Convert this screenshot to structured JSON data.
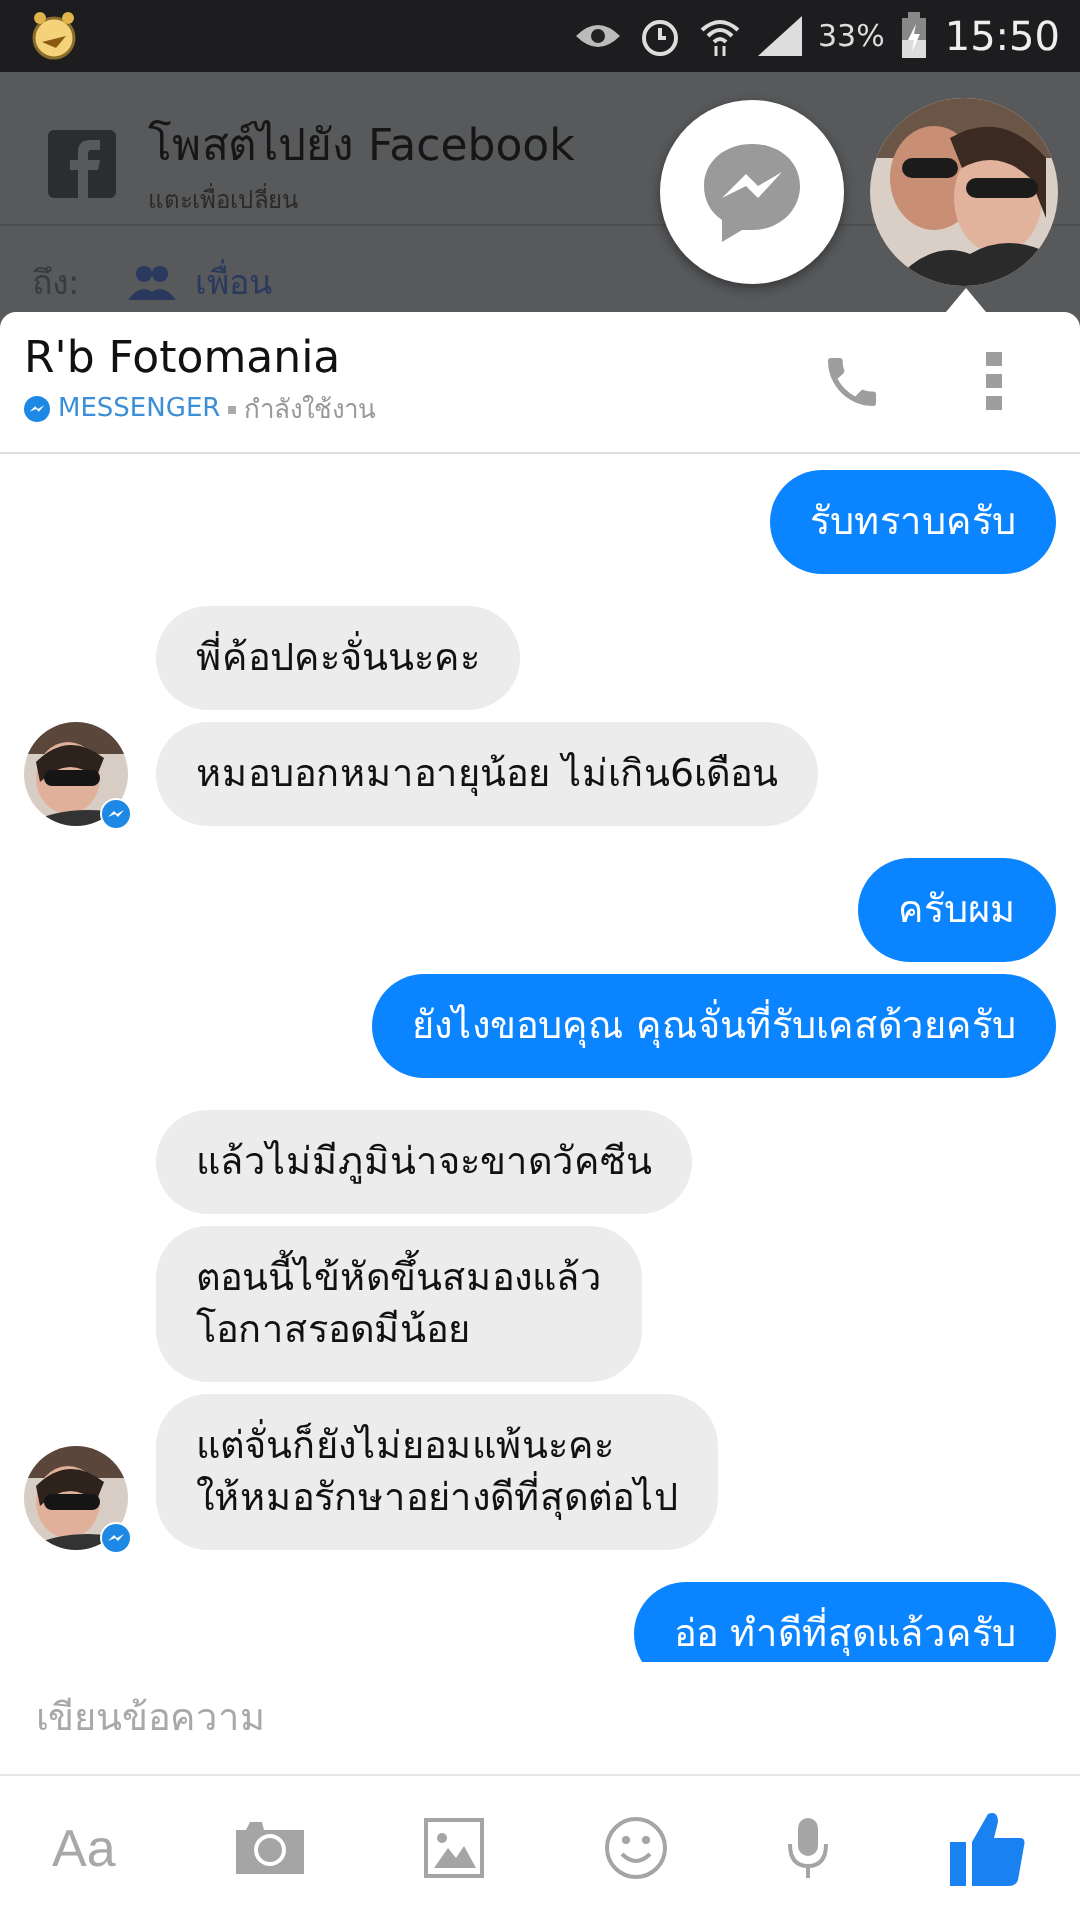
{
  "status_bar": {
    "battery": "33%",
    "time": "15:50"
  },
  "background_app": {
    "title": "โพสต์ไปยัง Facebook",
    "subtitle": "แตะเพื่อเปลี่ยน",
    "to_label": "ถึง:",
    "audience": "เพื่อน"
  },
  "chat_header": {
    "name": "R'b Fotomania",
    "app": "MESSENGER",
    "status": "กำลังใช้งาน"
  },
  "messages": [
    {
      "kind": "outgoing",
      "text": "รับทราบครับ"
    },
    {
      "kind": "incoming",
      "text": "พี่ค้อปคะจั่นนะคะ",
      "avatar": false
    },
    {
      "kind": "incoming",
      "text": "หมอบอกหมาอายุน้อย ไม่เกิน6เดือน",
      "avatar": true
    },
    {
      "kind": "outgoing",
      "text": "ครับผม"
    },
    {
      "kind": "outgoing",
      "text": "ยังไงขอบคุณ คุณจั่นที่รับเคสด้วยครับ"
    },
    {
      "kind": "incoming",
      "text": "แล้วไม่มีภูมิน่าจะขาดวัคซีน",
      "avatar": false
    },
    {
      "kind": "incoming",
      "text": "ตอนนี้ไข้หัดขึ้นสมองแล้ว\nโอกาสรอดมีน้อย",
      "avatar": false
    },
    {
      "kind": "incoming",
      "text": "แต่จั่นก็ยังไม่ยอมแพ้นะคะ\nให้หมอรักษาอย่างดีที่สุดต่อไป",
      "avatar": true
    },
    {
      "kind": "outgoing",
      "text": "อ่อ ทำดีที่สุดแล้วครับ"
    }
  ],
  "composer": {
    "placeholder": "เขียนข้อความ",
    "text_button": "Aa"
  }
}
